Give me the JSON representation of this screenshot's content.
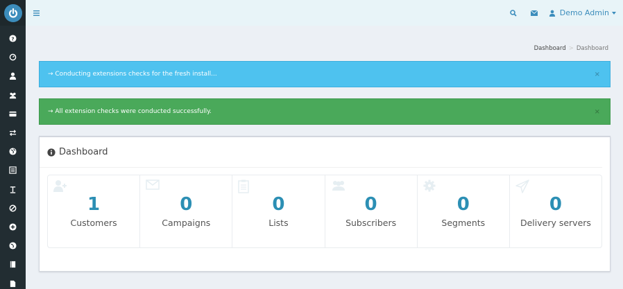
{
  "topbar": {
    "user_name": "Demo Admin"
  },
  "breadcrumb": {
    "home": "Dashboard",
    "separator": ">",
    "current": "Dashboard"
  },
  "alerts": {
    "info": {
      "text": "→ Conducting extensions checks for the fresh install...",
      "close": "×"
    },
    "success": {
      "text": "→ All extension checks were conducted successfully.",
      "close": "×"
    }
  },
  "dashboard": {
    "title": "Dashboard",
    "stats": [
      {
        "value": "1",
        "label": "Customers",
        "icon": "user-plus-icon"
      },
      {
        "value": "0",
        "label": "Campaigns",
        "icon": "envelope-icon"
      },
      {
        "value": "0",
        "label": "Lists",
        "icon": "clipboard-icon"
      },
      {
        "value": "0",
        "label": "Subscribers",
        "icon": "users-icon"
      },
      {
        "value": "0",
        "label": "Segments",
        "icon": "gear-icon"
      },
      {
        "value": "0",
        "label": "Delivery servers",
        "icon": "paper-plane-icon"
      }
    ]
  },
  "sidebar": {
    "items": [
      "question-circle-icon",
      "dashboard-icon",
      "user-icon",
      "users-icon",
      "credit-card-icon",
      "exchange-icon",
      "globe-icon",
      "list-icon",
      "text-icon",
      "ban-icon",
      "plus-circle-icon",
      "globe-alt-icon",
      "book-icon",
      "file-icon"
    ]
  },
  "colors": {
    "sidebar": "#222d32",
    "accent": "#3c8dbc",
    "info": "#4ec2ef",
    "success": "#4aa95a",
    "stat_number": "#2c8fb4"
  }
}
